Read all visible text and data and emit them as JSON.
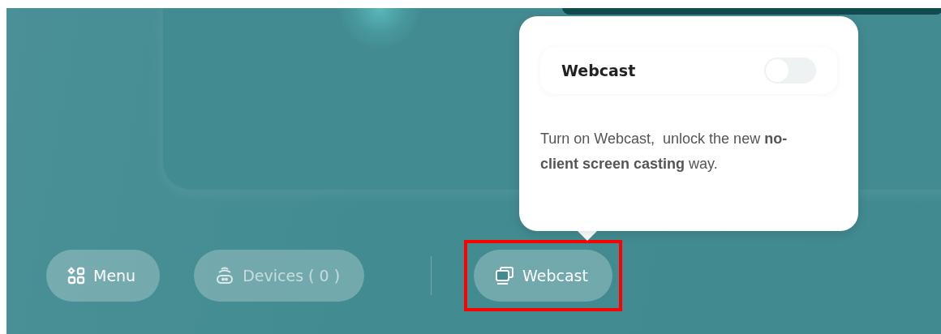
{
  "popover": {
    "title": "Webcast",
    "toggle_on": false,
    "description": "Turn on Webcast,  unlock the new **no-client screen casting** way."
  },
  "toolbar": {
    "left": [
      {
        "kind": "menu",
        "label": "Menu",
        "disabled": false,
        "highlighted": false
      },
      {
        "kind": "devices",
        "label": "Devices ( 0 )",
        "disabled": true,
        "highlighted": false
      }
    ],
    "right": [
      {
        "kind": "webcast",
        "label": "Webcast",
        "disabled": false,
        "highlighted": true
      }
    ]
  }
}
